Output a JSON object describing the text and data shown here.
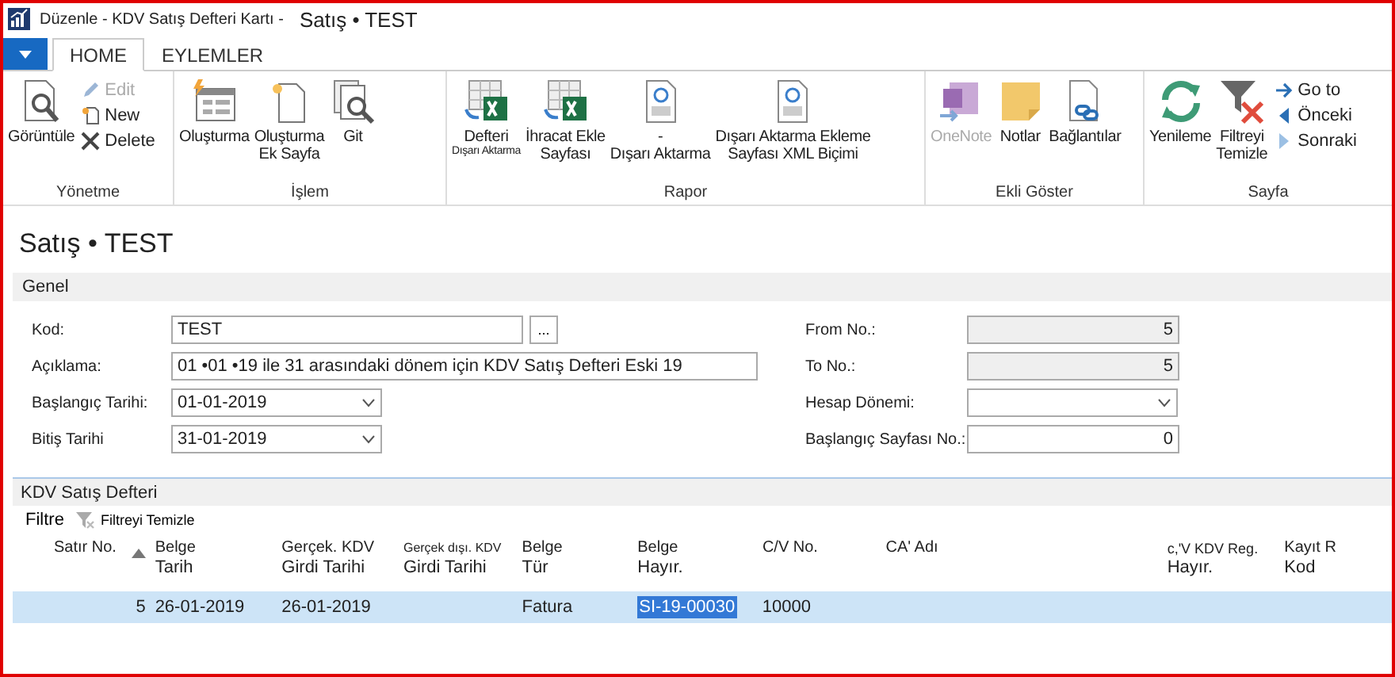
{
  "window": {
    "title": "Düzenle - KDV Satış Defteri Kartı -",
    "subtitle": "Satış • TEST"
  },
  "tabs": [
    {
      "label": "HOME",
      "selected": true
    },
    {
      "label": "EYLEMLER",
      "selected": false
    }
  ],
  "ribbon": {
    "groups": [
      {
        "label": "Yönetme",
        "items": [
          {
            "kind": "large",
            "label": "Görüntüle",
            "disabled": false
          },
          {
            "kind": "small",
            "label": "Edit",
            "disabled": true
          },
          {
            "kind": "small",
            "label": "New",
            "disabled": false
          },
          {
            "kind": "small",
            "label": "Delete",
            "disabled": false
          }
        ]
      },
      {
        "label": "İşlem",
        "items": [
          {
            "kind": "large",
            "label": "Oluşturma",
            "disabled": false
          },
          {
            "kind": "large",
            "label": "Oluşturma\nEk Sayfa",
            "disabled": false
          },
          {
            "kind": "large",
            "label": "Git",
            "disabled": false
          }
        ]
      },
      {
        "label": "Rapor",
        "items": [
          {
            "kind": "large",
            "label": "Defteri",
            "note": "Dışarı Aktarma",
            "disabled": false
          },
          {
            "kind": "large",
            "label": "İhracat Ekle\nSayfası",
            "disabled": false
          },
          {
            "kind": "large",
            "label": "-\nDışarı Aktarma",
            "disabled": false
          },
          {
            "kind": "large",
            "label": "Dışarı Aktarma Ekleme\nSayfası XML Biçimi",
            "disabled": false
          }
        ]
      },
      {
        "label": "Ekli Göster",
        "items": [
          {
            "kind": "large",
            "label": "OneNote",
            "disabled": true
          },
          {
            "kind": "large",
            "label": "Notlar",
            "disabled": false
          },
          {
            "kind": "large",
            "label": "Bağlantılar",
            "disabled": false
          }
        ]
      },
      {
        "label": "Sayfa",
        "items": [
          {
            "kind": "large",
            "label": "Yenileme",
            "disabled": false
          },
          {
            "kind": "large",
            "label": "Filtreyi\nTemizle",
            "disabled": false
          },
          {
            "kind": "small",
            "label": "Go to",
            "disabled": false
          },
          {
            "kind": "small",
            "label": "Önceki",
            "disabled": false
          },
          {
            "kind": "small",
            "label": "Sonraki",
            "disabled": false
          }
        ]
      }
    ]
  },
  "page_title": "Satış • TEST",
  "general": {
    "title": "Genel",
    "left_fields": [
      {
        "label": "Kod:",
        "value": "TEST",
        "kind": "lookup",
        "button": "..."
      },
      {
        "label": "Açıklama:",
        "value": "01 •01 •19 ile 31 arasındaki dönem için KDV Satış Defteri Eski 19",
        "kind": "wide"
      },
      {
        "label": "Başlangıç Tarihi:",
        "value": "01-01-2019",
        "kind": "dropdown"
      },
      {
        "label": "Bitiş Tarihi",
        "value": "31-01-2019",
        "kind": "dropdown"
      }
    ],
    "right_fields": [
      {
        "label": "From No.:",
        "value": "5",
        "kind": "number",
        "disabled": true
      },
      {
        "label": "To No.:",
        "value": "5",
        "kind": "number",
        "disabled": true
      },
      {
        "label": "Hesap Dönemi:",
        "kind": "dropdown",
        "disabled": false
      },
      {
        "label": "Başlangıç Sayfası No.:",
        "value": "0",
        "kind": "number",
        "disabled": false
      }
    ]
  },
  "subpage": {
    "title": "KDV Satış Defteri",
    "toolbar": {
      "filter": "Filtre",
      "clear": "Filtreyi Temizle"
    },
    "columns": [
      {
        "top": "Satır No.",
        "sorted": true
      },
      {
        "top": "Belge",
        "bottom": "Tarih",
        "sorted": false
      },
      {
        "top": "Gerçek. KDV",
        "bottom": "Girdi Tarihi",
        "sorted": false
      },
      {
        "top": "Gerçek dışı. KDV",
        "bottom": "Girdi Tarihi",
        "sorted": false
      },
      {
        "top": "Belge",
        "bottom": "Tür",
        "sorted": false
      },
      {
        "top": "Belge",
        "bottom": "Hayır.",
        "sorted": false
      },
      {
        "top": "C/V No.",
        "sorted": false
      },
      {
        "top": "CA' Adı",
        "sorted": false
      },
      {
        "top": "c,'V KDV Reg.",
        "bottom": "Hayır.",
        "sorted": false
      },
      {
        "top": "Kayıt R",
        "bottom": "Kod",
        "sorted": false
      }
    ],
    "rows": [
      {
        "selected": true,
        "cells": [
          {
            "text": "5",
            "focused": false
          },
          {
            "text": "26-01-2019",
            "focused": false
          },
          {
            "text": "26-01-2019",
            "focused": false
          },
          {},
          {
            "text": "Fatura",
            "focused": false
          },
          {
            "text": "SI-19-00030",
            "focused": true
          },
          {
            "text": "10000",
            "focused": false
          },
          {},
          {},
          {}
        ]
      }
    ]
  }
}
